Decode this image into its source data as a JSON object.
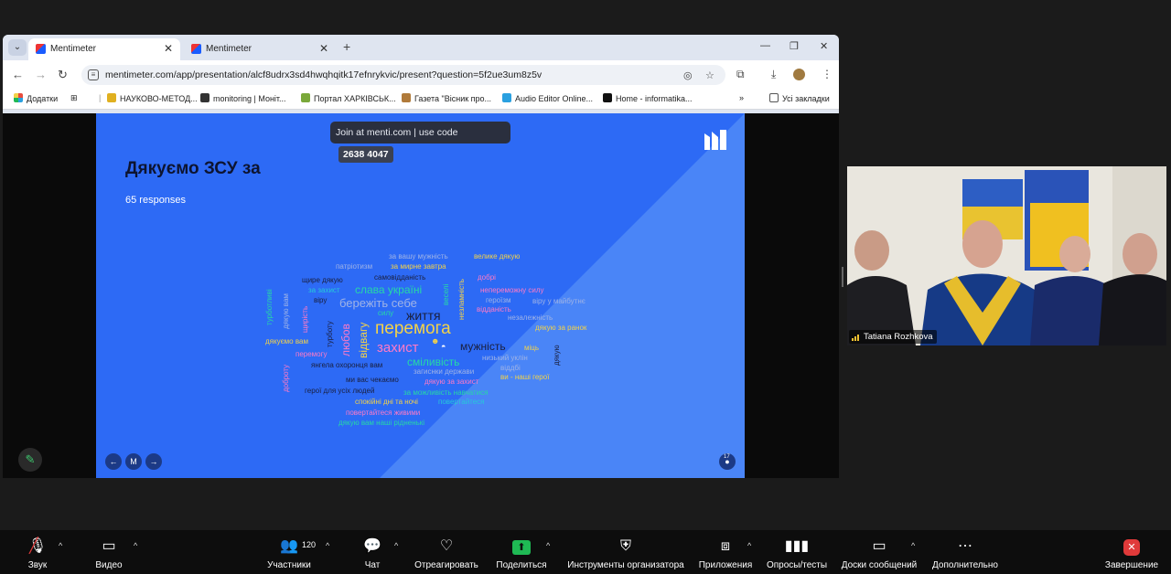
{
  "browser": {
    "tabs": [
      {
        "title": "Mentimeter",
        "active": true
      },
      {
        "title": "Mentimeter",
        "active": false
      }
    ],
    "url": "mentimeter.com/app/presentation/alcf8udrx3sd4hwqhqitk17efnrykvic/present?question=5f2ue3um8z5v",
    "bookmarks": [
      {
        "label": "Додатки",
        "icon": "apps-grid-icon",
        "color": "#e84c3d"
      },
      {
        "label": "НАУКОВО-МЕТОД...",
        "icon": "bookmark-favicon",
        "color": "#e0b020"
      },
      {
        "label": "monitoring | Моніт...",
        "icon": "bookmark-favicon",
        "color": "#333333"
      },
      {
        "label": "Портал ХАРКІВСЬК...",
        "icon": "bookmark-favicon",
        "color": "#7aa83a"
      },
      {
        "label": "Газета \"Вісник про...",
        "icon": "bookmark-favicon",
        "color": "#b07a3a"
      },
      {
        "label": "Audio Editor Online...",
        "icon": "bookmark-favicon",
        "color": "#2aa0e0"
      },
      {
        "label": "Home - informatika...",
        "icon": "bookmark-favicon",
        "color": "#111111"
      }
    ],
    "all_bookmarks": "Усі закладки"
  },
  "slide": {
    "join_text": "Join at menti.com | use code",
    "code": "2638 4047",
    "title": "Дякуємо ЗСУ за",
    "subtitle": "65 responses",
    "colors": {
      "bg": "#2d6af5",
      "bg_light": "#4a85f7"
    },
    "words": [
      {
        "t": "за вашу мужність",
        "c": "#9fb3e6"
      },
      {
        "t": "велике дякую",
        "c": "#f2d24a"
      },
      {
        "t": "патріотизм",
        "c": "#9fb3e6"
      },
      {
        "t": "за мирне завтра",
        "c": "#f2d24a"
      },
      {
        "t": "щире дякую",
        "c": "#1a1f3d"
      },
      {
        "t": "самовідданість",
        "c": "#1a1f3d"
      },
      {
        "t": "добрі",
        "c": "#ff7ac6"
      },
      {
        "t": "за захист",
        "c": "#26c9d9"
      },
      {
        "t": "слава україні",
        "c": "#26d9a6"
      },
      {
        "t": "непереможну силу",
        "c": "#ff7ac6"
      },
      {
        "t": "віру",
        "c": "#1a1f3d"
      },
      {
        "t": "бережіть себе",
        "c": "#9fb3e6"
      },
      {
        "t": "героїзм",
        "c": "#9fb3e6"
      },
      {
        "t": "віру у майбутнє",
        "c": "#9fb3e6"
      },
      {
        "t": "силу",
        "c": "#26d9a6"
      },
      {
        "t": "відданість",
        "c": "#ff7ac6"
      },
      {
        "t": "життя",
        "c": "#1a1f3d"
      },
      {
        "t": "незалежність",
        "c": "#9fb3e6"
      },
      {
        "t": "перемога",
        "c": "#f2d24a"
      },
      {
        "t": "дякую за ранок",
        "c": "#f2d24a"
      },
      {
        "t": "дякуємо вам",
        "c": "#f2d24a"
      },
      {
        "t": "захист",
        "c": "#ff7ac6"
      },
      {
        "t": "мужність",
        "c": "#1a1f3d"
      },
      {
        "t": "міць",
        "c": "#f2d24a"
      },
      {
        "t": "перемогу",
        "c": "#ff7ac6"
      },
      {
        "t": "сміливість",
        "c": "#26d9a6"
      },
      {
        "t": "низький уклін",
        "c": "#9fb3e6"
      },
      {
        "t": "янгела охоронця вам",
        "c": "#1a1f3d"
      },
      {
        "t": "віддбі",
        "c": "#9fb3e6"
      },
      {
        "t": "загиснки держави",
        "c": "#9fb3e6"
      },
      {
        "t": "ви - наші герої",
        "c": "#f2d24a"
      },
      {
        "t": "ми вас чекаємо",
        "c": "#1a1f3d"
      },
      {
        "t": "дякую за захист",
        "c": "#ff7ac6"
      },
      {
        "t": "герої для усіх людей",
        "c": "#1a1f3d"
      },
      {
        "t": "за можливість навчатися",
        "c": "#26d9a6"
      },
      {
        "t": "спокійні дні та ночі",
        "c": "#f2d24a"
      },
      {
        "t": "повертайтеся",
        "c": "#26c9d9"
      },
      {
        "t": "повертайтеся живими",
        "c": "#ff7ac6"
      },
      {
        "t": "дякую вам наші рідненькі",
        "c": "#26d9a6"
      },
      {
        "t": "турботливі",
        "c": "#26d9a6"
      },
      {
        "t": "дякую вам",
        "c": "#9fb3e6"
      },
      {
        "t": "щирість",
        "c": "#ff7ac6"
      },
      {
        "t": "турботу",
        "c": "#1a1f3d"
      },
      {
        "t": "любов",
        "c": "#ff7ac6"
      },
      {
        "t": "відвагу",
        "c": "#f2d24a"
      },
      {
        "t": "веселі",
        "c": "#26d9a6"
      },
      {
        "t": "незламність",
        "c": "#f2d24a"
      },
      {
        "t": "доброту",
        "c": "#ff7ac6"
      },
      {
        "t": "дякую",
        "c": "#1a1f3d"
      }
    ]
  },
  "slide_nav": {
    "prev": "←",
    "home": "M",
    "next": "→",
    "audience_count": "17"
  },
  "video": {
    "participant_name": "Tatiana Rozhkova"
  },
  "zoom_toolbar": {
    "audio": "Звук",
    "video": "Видео",
    "participants": "Участники",
    "participants_count": "120",
    "chat": "Чат",
    "react": "Отреагировать",
    "share": "Поделиться",
    "host_tools": "Инструменты организатора",
    "apps": "Приложения",
    "polls": "Опросы/тесты",
    "whiteboards": "Доски сообщений",
    "more": "Дополнительно",
    "end": "Завершение",
    "accent": "#1fb954",
    "end_color": "#e03a3a"
  }
}
